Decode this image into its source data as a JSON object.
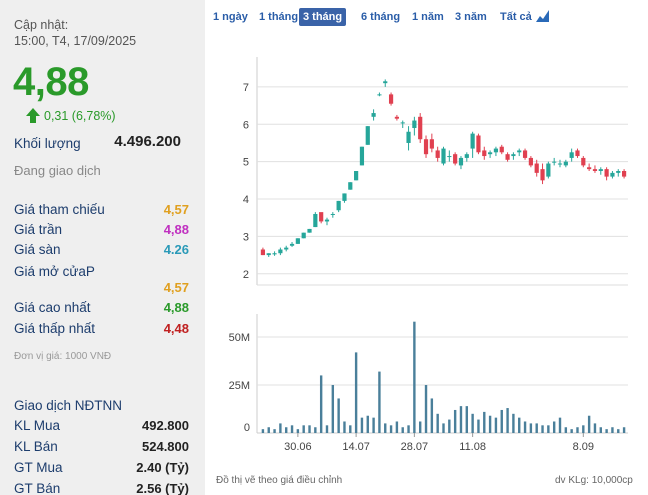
{
  "stock": {
    "updated_label": "Cập nhật:",
    "updated_time": "15:00, T4, 17/09/2025",
    "price": "4,88",
    "change": "0,31 (6,78%)",
    "volume_label": "Khối lượng",
    "volume_value": "4.496.200",
    "status": "Đang giao dịch"
  },
  "price_info": [
    {
      "label": "Giá tham chiếu",
      "value": "4,57",
      "color": "#e0a020"
    },
    {
      "label": "Giá trần",
      "value": "4,88",
      "color": "#c030c0"
    },
    {
      "label": "Giá sàn",
      "value": "4.26",
      "color": "#2a9ab8"
    },
    {
      "label": "Giá mở cửaP",
      "value": "4,57",
      "color": "#e0a020"
    },
    {
      "label": "Giá cao nhất",
      "value": "4,88",
      "color": "#2a9a2a"
    },
    {
      "label": "Giá thấp nhất",
      "value": "4,48",
      "color": "#c02020"
    }
  ],
  "unit_note": "Đơn vị giá: 1000 VNĐ",
  "foreign": {
    "title": "Giao dịch NĐTNN",
    "rows": [
      {
        "label": "KL Mua",
        "value": "492.800"
      },
      {
        "label": "KL Bán",
        "value": "524.800"
      },
      {
        "label": "GT Mua",
        "value": "2.40 (Tỷ)"
      },
      {
        "label": "GT Bán",
        "value": "2.56 (Tỷ)"
      }
    ]
  },
  "tabs": [
    "1 ngày",
    "1 tháng",
    "3 tháng",
    "6 tháng",
    "1 năm",
    "3 năm",
    "Tất cả"
  ],
  "active_tab": "3 tháng",
  "footer": {
    "left": "Đồ thị vẽ theo giá điều chỉnh",
    "right": "dv KLg: 10,000cp"
  },
  "colors": {
    "up": "#26a69a",
    "down": "#e04050",
    "volume": "#4a7f9a",
    "grid": "#e0e0e0"
  },
  "chart_data": {
    "type": "candlestick",
    "price_axis": {
      "ticks": [
        "2",
        "3",
        "4",
        "5",
        "6",
        "7"
      ],
      "ylim": [
        1.7,
        7.8
      ]
    },
    "volume_axis": {
      "ticks": [
        "0",
        "25M",
        "50M"
      ],
      "ylim": [
        0,
        62
      ]
    },
    "x_ticks": [
      "30.06",
      "14.07",
      "28.07",
      "11.08",
      "8.09"
    ],
    "x_tick_index": [
      6,
      16,
      26,
      36,
      55
    ],
    "candles": [
      {
        "o": 2.65,
        "h": 2.7,
        "l": 2.5,
        "c": 2.5
      },
      {
        "o": 2.5,
        "h": 2.55,
        "l": 2.45,
        "c": 2.55
      },
      {
        "o": 2.52,
        "h": 2.6,
        "l": 2.48,
        "c": 2.55
      },
      {
        "o": 2.55,
        "h": 2.7,
        "l": 2.5,
        "c": 2.65
      },
      {
        "o": 2.65,
        "h": 2.75,
        "l": 2.6,
        "c": 2.7
      },
      {
        "o": 2.75,
        "h": 2.85,
        "l": 2.72,
        "c": 2.8
      },
      {
        "o": 2.8,
        "h": 2.95,
        "l": 2.8,
        "c": 2.95
      },
      {
        "o": 2.95,
        "h": 3.1,
        "l": 2.95,
        "c": 3.1
      },
      {
        "o": 3.1,
        "h": 3.2,
        "l": 3.1,
        "c": 3.2
      },
      {
        "o": 3.25,
        "h": 3.65,
        "l": 3.25,
        "c": 3.6
      },
      {
        "o": 3.65,
        "h": 3.4,
        "l": 3.35,
        "c": 3.4
      },
      {
        "o": 3.4,
        "h": 3.5,
        "l": 3.3,
        "c": 3.45
      },
      {
        "o": 3.6,
        "h": 3.65,
        "l": 3.5,
        "c": 3.6
      },
      {
        "o": 3.7,
        "h": 3.95,
        "l": 3.65,
        "c": 3.95
      },
      {
        "o": 3.95,
        "h": 4.15,
        "l": 3.9,
        "c": 4.15
      },
      {
        "o": 4.25,
        "h": 4.45,
        "l": 4.25,
        "c": 4.45
      },
      {
        "o": 4.5,
        "h": 4.75,
        "l": 4.5,
        "c": 4.75
      },
      {
        "o": 4.9,
        "h": 5.4,
        "l": 4.9,
        "c": 5.4
      },
      {
        "o": 5.45,
        "h": 5.95,
        "l": 5.45,
        "c": 5.95
      },
      {
        "o": 6.2,
        "h": 6.4,
        "l": 6.1,
        "c": 6.3
      },
      {
        "o": 6.8,
        "h": 6.85,
        "l": 6.75,
        "c": 6.8
      },
      {
        "o": 7.1,
        "h": 7.2,
        "l": 7.0,
        "c": 7.15
      },
      {
        "o": 6.8,
        "h": 6.85,
        "l": 6.5,
        "c": 6.55
      },
      {
        "o": 6.2,
        "h": 6.25,
        "l": 6.1,
        "c": 6.15
      },
      {
        "o": 6.05,
        "h": 6.1,
        "l": 5.9,
        "c": 6.05
      },
      {
        "o": 5.5,
        "h": 5.95,
        "l": 5.3,
        "c": 5.8
      },
      {
        "o": 5.9,
        "h": 6.2,
        "l": 5.7,
        "c": 6.1
      },
      {
        "o": 6.2,
        "h": 6.3,
        "l": 5.5,
        "c": 5.6
      },
      {
        "o": 5.6,
        "h": 5.7,
        "l": 5.1,
        "c": 5.2
      },
      {
        "o": 5.6,
        "h": 5.75,
        "l": 5.25,
        "c": 5.35
      },
      {
        "o": 5.3,
        "h": 5.4,
        "l": 5.0,
        "c": 5.1
      },
      {
        "o": 4.95,
        "h": 5.4,
        "l": 4.9,
        "c": 5.35
      },
      {
        "o": 5.15,
        "h": 5.3,
        "l": 5.0,
        "c": 5.15
      },
      {
        "o": 5.2,
        "h": 5.25,
        "l": 4.9,
        "c": 4.95
      },
      {
        "o": 4.9,
        "h": 5.15,
        "l": 4.8,
        "c": 5.1
      },
      {
        "o": 5.1,
        "h": 5.25,
        "l": 5.0,
        "c": 5.2
      },
      {
        "o": 5.35,
        "h": 5.8,
        "l": 5.1,
        "c": 5.75
      },
      {
        "o": 5.7,
        "h": 5.75,
        "l": 5.2,
        "c": 5.25
      },
      {
        "o": 5.3,
        "h": 5.4,
        "l": 5.05,
        "c": 5.15
      },
      {
        "o": 5.2,
        "h": 5.3,
        "l": 5.1,
        "c": 5.25
      },
      {
        "o": 5.25,
        "h": 5.4,
        "l": 5.15,
        "c": 5.35
      },
      {
        "o": 5.4,
        "h": 5.45,
        "l": 5.2,
        "c": 5.25
      },
      {
        "o": 5.2,
        "h": 5.25,
        "l": 5.0,
        "c": 5.05
      },
      {
        "o": 5.15,
        "h": 5.25,
        "l": 5.05,
        "c": 5.2
      },
      {
        "o": 5.25,
        "h": 5.35,
        "l": 5.15,
        "c": 5.3
      },
      {
        "o": 5.3,
        "h": 5.35,
        "l": 5.05,
        "c": 5.1
      },
      {
        "o": 5.1,
        "h": 5.15,
        "l": 4.85,
        "c": 4.9
      },
      {
        "o": 4.95,
        "h": 5.05,
        "l": 4.6,
        "c": 4.7
      },
      {
        "o": 4.8,
        "h": 4.95,
        "l": 4.4,
        "c": 4.5
      },
      {
        "o": 4.6,
        "h": 5.0,
        "l": 4.55,
        "c": 4.95
      },
      {
        "o": 5.0,
        "h": 5.1,
        "l": 4.9,
        "c": 5.0
      },
      {
        "o": 4.95,
        "h": 5.05,
        "l": 4.85,
        "c": 4.95
      },
      {
        "o": 4.9,
        "h": 5.05,
        "l": 4.85,
        "c": 5.0
      },
      {
        "o": 5.1,
        "h": 5.35,
        "l": 5.0,
        "c": 5.25
      },
      {
        "o": 5.3,
        "h": 5.35,
        "l": 5.1,
        "c": 5.15
      },
      {
        "o": 5.1,
        "h": 5.15,
        "l": 4.85,
        "c": 4.9
      },
      {
        "o": 4.85,
        "h": 4.95,
        "l": 4.75,
        "c": 4.8
      },
      {
        "o": 4.8,
        "h": 4.9,
        "l": 4.7,
        "c": 4.75
      },
      {
        "o": 4.75,
        "h": 4.85,
        "l": 4.65,
        "c": 4.8
      },
      {
        "o": 4.8,
        "h": 4.85,
        "l": 4.5,
        "c": 4.6
      },
      {
        "o": 4.6,
        "h": 4.75,
        "l": 4.55,
        "c": 4.7
      },
      {
        "o": 4.7,
        "h": 4.8,
        "l": 4.6,
        "c": 4.75
      },
      {
        "o": 4.75,
        "h": 4.8,
        "l": 4.55,
        "c": 4.6
      }
    ],
    "volume": [
      2,
      3,
      2,
      5,
      3,
      4,
      2,
      4,
      4,
      3,
      30,
      4,
      25,
      18,
      6,
      4,
      42,
      8,
      9,
      8,
      32,
      5,
      4,
      6,
      3,
      4,
      58,
      6,
      25,
      18,
      10,
      5,
      7,
      12,
      14,
      14,
      10,
      7,
      11,
      9,
      8,
      12,
      13,
      10,
      8,
      6,
      5,
      5,
      4,
      4,
      6,
      8,
      3,
      2,
      3,
      4,
      9,
      5,
      3,
      2,
      3,
      2,
      3
    ]
  }
}
